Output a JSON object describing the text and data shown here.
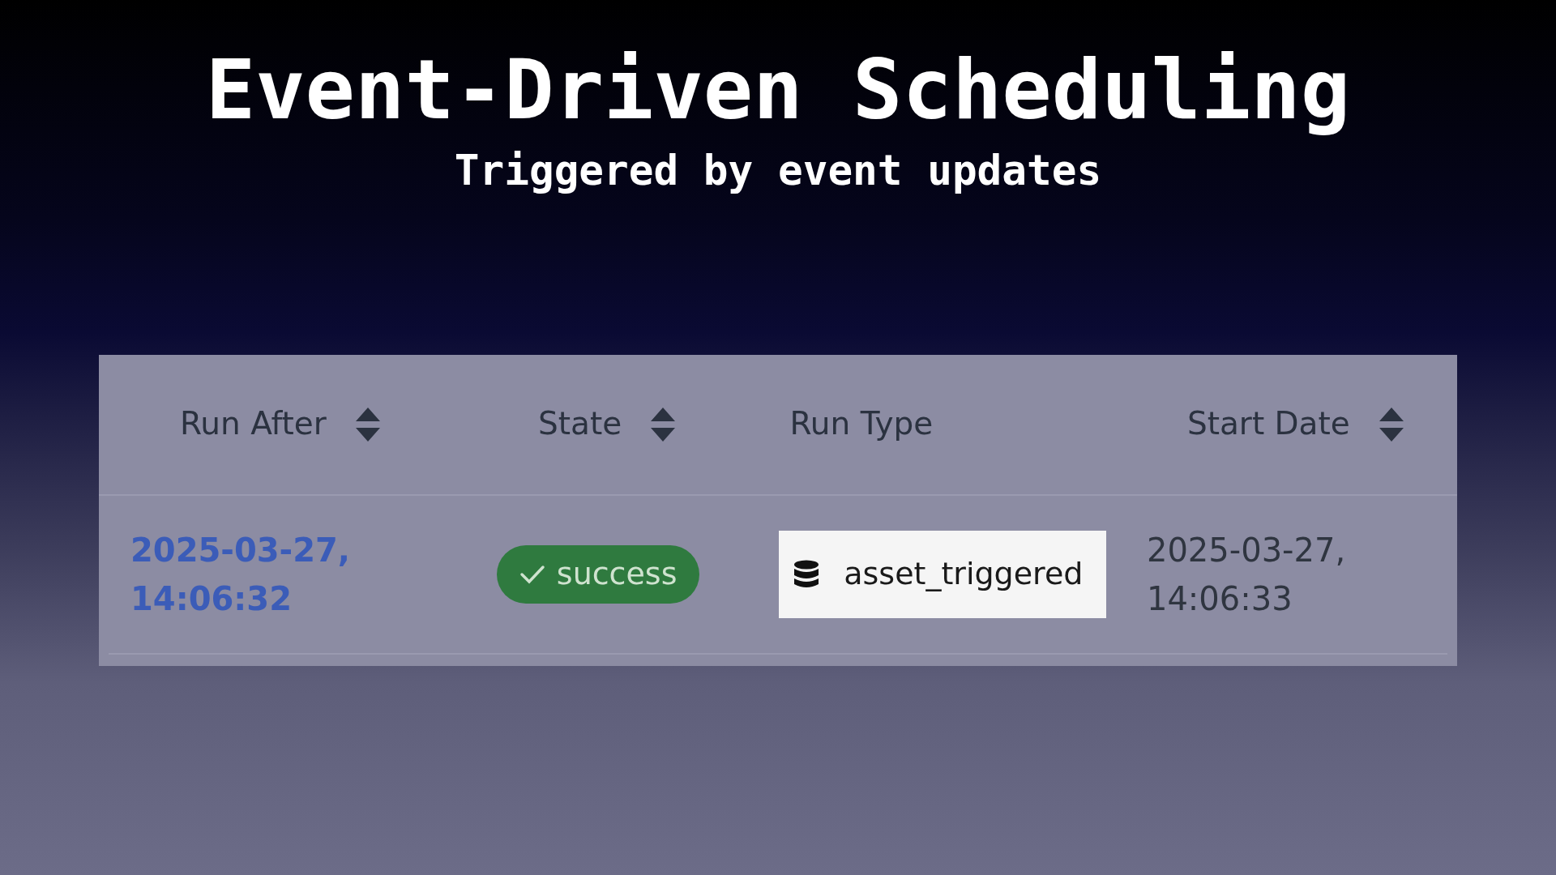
{
  "title": "Event-Driven Scheduling",
  "subtitle": "Triggered by event updates",
  "table": {
    "columns": [
      {
        "label": "Run After",
        "sortable": true
      },
      {
        "label": "State",
        "sortable": true
      },
      {
        "label": "Run Type",
        "sortable": false
      },
      {
        "label": "Start Date",
        "sortable": true
      }
    ],
    "rows": [
      {
        "run_after": "2025-03-27, 14:06:32",
        "state": {
          "label": "success",
          "kind": "success"
        },
        "run_type": "asset_triggered",
        "start_date": "2025-03-27, 14:06:33"
      }
    ]
  }
}
